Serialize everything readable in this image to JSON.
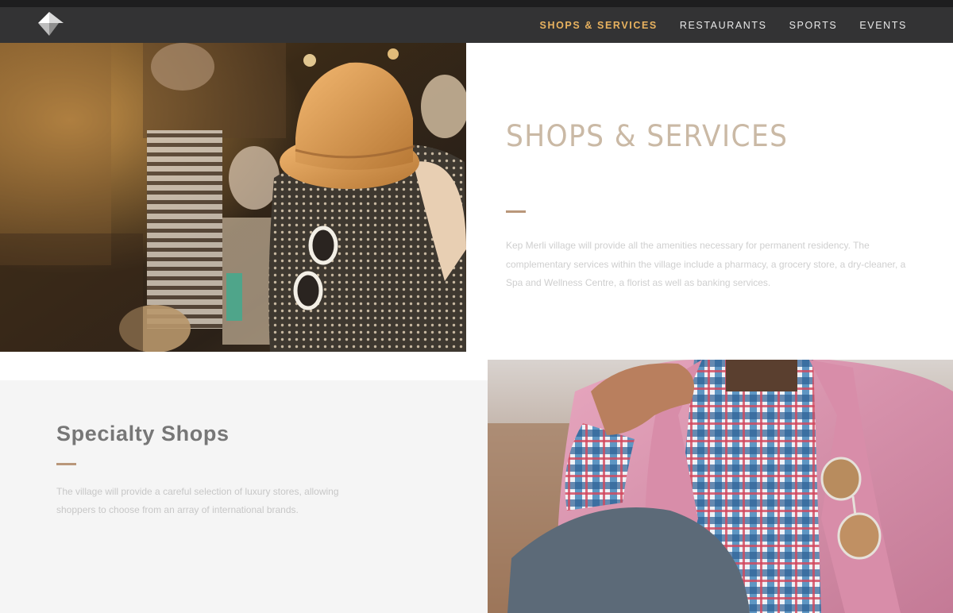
{
  "nav": {
    "items": [
      {
        "label": "SHOPS & SERVICES",
        "active": true
      },
      {
        "label": "RESTAURANTS",
        "active": false
      },
      {
        "label": "SPORTS",
        "active": false
      },
      {
        "label": "EVENTS",
        "active": false
      }
    ],
    "active_color": "#e8b25f"
  },
  "hero": {
    "title": "SHOPS & SERVICES",
    "body": "Kep Merli village will provide all the amenities necessary for permanent residency. The complementary services within the village include a pharmacy, a grocery store, a dry-cleaner, a Spa and Wellness Centre, a florist as well as banking services."
  },
  "specialty": {
    "title": "Specialty Shops",
    "body": "The village will provide a careful selection of luxury stores, allowing shoppers to choose from an array of international brands."
  },
  "colors": {
    "accent_rule": "#b9977a",
    "hero_title": "#c5b29c",
    "navbar": "#333334"
  }
}
